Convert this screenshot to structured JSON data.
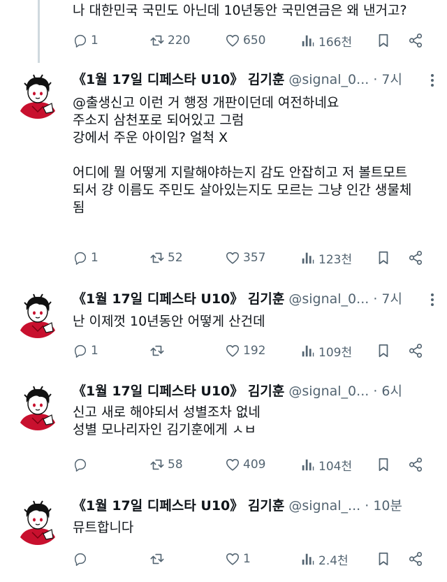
{
  "top_tweet": {
    "text": "나 대한민국 국민도 아닌데 10년동안 국민연금은 왜 낸거고?",
    "replies": "1",
    "retweets": "220",
    "likes": "650",
    "views": "166천"
  },
  "tweets": [
    {
      "name": "《1월 17일 디페스타 U10》 김기훈",
      "handle": "@signal_0...",
      "time": "· 7시",
      "lines": [
        "@출생신고 이런 거 행정 개판이던데 여전하네요",
        "주소지 삼천포로 되어있고 그럼",
        "강에서 주운 아이임? 얼척 X",
        "",
        "어디에 뭘 어떻게 지랄해야하는지 감도 안잡히고 저 볼트모트",
        "되서 걍 이름도 주민도 살아있는지도 모르는 그냥 인간 생물체",
        "됨"
      ],
      "replies": "1",
      "retweets": "52",
      "likes": "357",
      "views": "123천"
    },
    {
      "name": "《1월 17일 디페스타 U10》 김기훈",
      "handle": "@signal_0...",
      "time": "· 7시",
      "lines": [
        "난 이제껏 10년동안 어떻게 산건데"
      ],
      "replies": "1",
      "retweets": "",
      "likes": "192",
      "views": "109천"
    },
    {
      "name": "《1월 17일 디페스타 U10》 김기훈",
      "handle": "@signal_0...",
      "time": "· 6시",
      "lines": [
        "신고 새로 해야되서 성별조차 없네",
        "성별 모나리자인 김기훈에게 ㅅㅂ"
      ],
      "replies": "",
      "retweets": "58",
      "likes": "409",
      "views": "104천"
    },
    {
      "name": "《1월 17일 디페스타 U10》 김기훈",
      "handle": "@signal_...",
      "time": "· 10분",
      "lines": [
        "뮤트합니다"
      ],
      "replies": "",
      "retweets": "",
      "likes": "1",
      "views": "2.4천"
    }
  ]
}
